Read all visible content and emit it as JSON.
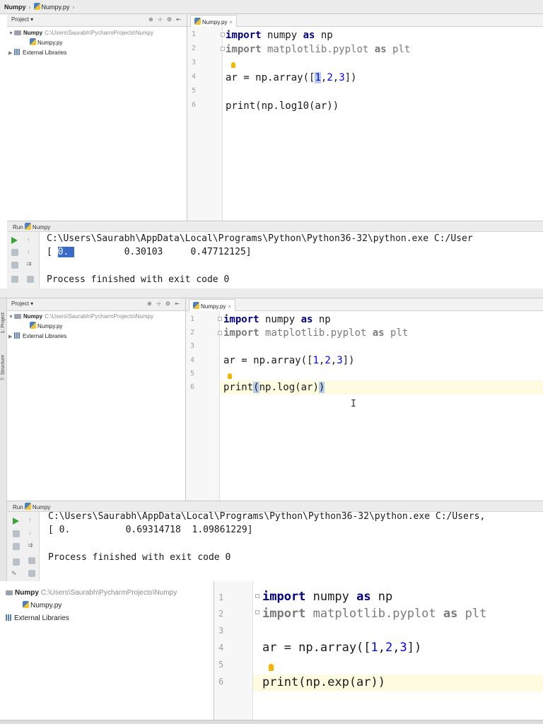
{
  "colors": {
    "keyword": "#000080",
    "number": "#0000ff",
    "selection": "#3a6ac8",
    "caret_highlight": "#b6cdea",
    "run_green": "#3aa23a"
  },
  "panel1": {
    "breadcrumb": [
      "Numpy",
      "Numpy.py"
    ],
    "project_label": "Project",
    "project_root": "Numpy",
    "project_path": "C:\\Users\\Saurabh\\PycharmProjects\\Numpy",
    "file": "Numpy.py",
    "libraries": "External Libraries",
    "tab_label": "Numpy.py",
    "line_numbers": [
      "1",
      "2",
      "3",
      "4",
      "5",
      "6"
    ],
    "code": {
      "l1_kw": "import",
      "l1_mod": " numpy ",
      "l1_as": "as",
      "l1_alias": " np",
      "l2_kw": "import",
      "l2_mod": " matplotlib.pyplot ",
      "l2_as": "as",
      "l2_alias": " plt",
      "l4_pre": "ar = np.array([",
      "l4_n1": "1",
      "l4_c1": ",",
      "l4_n2": "2",
      "l4_c2": ",",
      "l4_n3": "3",
      "l4_post": "])",
      "l6": "print(np.log10(ar))"
    },
    "run_label": "Run",
    "run_config": "Numpy",
    "console_cmd": "C:\\Users\\Saurabh\\AppData\\Local\\Programs\\Python\\Python36-32\\python.exe C:/User",
    "console_out_pre": "[ ",
    "console_out_sel": "0. ",
    "console_out_post": "         0.30103     0.47712125]",
    "console_done": "Process finished with exit code 0"
  },
  "panel2": {
    "breadcrumb": [
      "Numpy",
      "Numpy.py"
    ],
    "project_label": "Project",
    "project_root": "Numpy",
    "project_path": "C:\\Users\\Saurabh\\PycharmProjects\\Numpy",
    "file": "Numpy.py",
    "libraries": "External Libraries",
    "tab_label": "Numpy.py",
    "side_tabs": [
      "1: Project",
      "7: Structure"
    ],
    "line_numbers": [
      "1",
      "2",
      "3",
      "4",
      "5",
      "6"
    ],
    "code": {
      "l1_kw": "import",
      "l1_mod": " numpy ",
      "l1_as": "as",
      "l1_alias": " np",
      "l2_kw": "import",
      "l2_mod": " matplotlib.pyplot ",
      "l2_as": "as",
      "l2_alias": " plt",
      "l4_pre": "ar = np.array([",
      "l4_n1": "1",
      "l4_c1": ",",
      "l4_n2": "2",
      "l4_c2": ",",
      "l4_n3": "3",
      "l4_post": "])",
      "l6_a": "print",
      "l6_b": "(",
      "l6_c": "np.log(ar)",
      "l6_d": ")"
    },
    "run_label": "Run",
    "run_config": "Numpy",
    "console_cmd": "C:\\Users\\Saurabh\\AppData\\Local\\Programs\\Python\\Python36-32\\python.exe C:/Users,",
    "console_out": "[ 0.          0.69314718  1.09861229]",
    "console_done": "Process finished with exit code 0"
  },
  "panel3": {
    "project_root": "Numpy",
    "project_path": "C:\\Users\\Saurabh\\PycharmProjects\\Numpy",
    "file": "Numpy.py",
    "libraries": "External Libraries",
    "line_numbers": [
      "1",
      "2",
      "3",
      "4",
      "5",
      "6"
    ],
    "code": {
      "l1_kw": "import",
      "l1_mod": " numpy ",
      "l1_as": "as",
      "l1_alias": " np",
      "l2_kw": "import",
      "l2_mod": " matplotlib.pyplot ",
      "l2_as": "as",
      "l2_alias": " plt",
      "l4_pre": "ar = np.array([",
      "l4_n1": "1",
      "l4_c1": ",",
      "l4_n2": "2",
      "l4_c2": ",",
      "l4_n3": "3",
      "l4_post": "])",
      "l6": "print(np.exp(ar))"
    }
  }
}
